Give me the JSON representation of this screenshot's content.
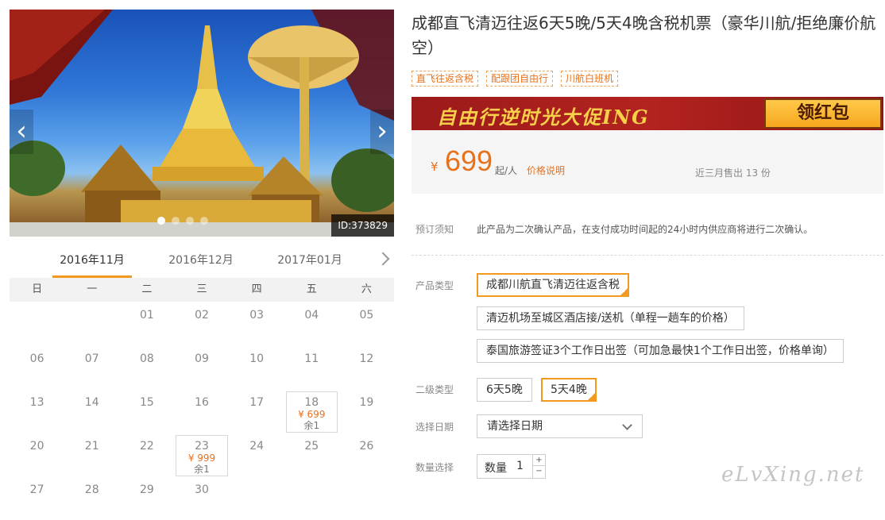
{
  "gallery": {
    "photo_id": "ID:373829",
    "prev_icon": "chevron-left-icon",
    "next_icon": "chevron-right-icon",
    "slide_count": 4,
    "active_slide": 1
  },
  "calendar": {
    "months": [
      "2016年11月",
      "2016年12月",
      "2017年01月"
    ],
    "active_month": 0,
    "weekdays": [
      "日",
      "一",
      "二",
      "三",
      "四",
      "五",
      "六"
    ],
    "rows": [
      [
        {
          "day": ""
        },
        {
          "day": ""
        },
        {
          "day": "01"
        },
        {
          "day": "02"
        },
        {
          "day": "03"
        },
        {
          "day": "04"
        },
        {
          "day": "05"
        }
      ],
      [
        {
          "day": "06"
        },
        {
          "day": "07"
        },
        {
          "day": "08"
        },
        {
          "day": "09"
        },
        {
          "day": "10"
        },
        {
          "day": "11"
        },
        {
          "day": "12"
        }
      ],
      [
        {
          "day": "13"
        },
        {
          "day": "14"
        },
        {
          "day": "15"
        },
        {
          "day": "16"
        },
        {
          "day": "17"
        },
        {
          "day": "18",
          "price": "¥ 699",
          "remain": "余1"
        },
        {
          "day": "19"
        }
      ],
      [
        {
          "day": "20"
        },
        {
          "day": "21"
        },
        {
          "day": "22"
        },
        {
          "day": "23",
          "price": "¥ 999",
          "remain": "余1"
        },
        {
          "day": "24"
        },
        {
          "day": "25"
        },
        {
          "day": "26"
        }
      ],
      [
        {
          "day": "27"
        },
        {
          "day": "28"
        },
        {
          "day": "29"
        },
        {
          "day": "30"
        },
        {
          "day": ""
        },
        {
          "day": ""
        },
        {
          "day": ""
        }
      ]
    ]
  },
  "product": {
    "title": "成都直飞清迈往返6天5晚/5天4晚含税机票（豪华川航/拒绝廉价航空）",
    "tags": [
      "直飞往返含税",
      "配跟团自由行",
      "川航白班机"
    ],
    "promo": {
      "text": "自由行逆时光大促ING",
      "button": "领红包"
    },
    "price": {
      "currency": "¥",
      "amount": "699",
      "unit": "起/人",
      "explain_link": "价格说明",
      "sold": "近三月售出 13 份"
    }
  },
  "booking": {
    "notice_label": "预订须知",
    "notice_text": "此产品为二次确认产品，在支付成功时间起的24小时内供应商将进行二次确认。",
    "type_label": "产品类型",
    "types": [
      {
        "label": "成都川航直飞清迈往返含税",
        "selected": true
      },
      {
        "label": "清迈机场至城区酒店接/送机（单程一趟车的价格）",
        "selected": false
      },
      {
        "label": "泰国旅游签证3个工作日出签（可加急最快1个工作日出签，价格单询）",
        "selected": false
      }
    ],
    "subtype_label": "二级类型",
    "subtypes": [
      {
        "label": "6天5晚",
        "selected": false
      },
      {
        "label": "5天4晚",
        "selected": true
      }
    ],
    "date_label": "选择日期",
    "date_placeholder": "请选择日期",
    "qty_label": "数量选择",
    "qty_field_label": "数量",
    "qty_value": "1",
    "qty_plus": "+",
    "qty_minus": "−"
  },
  "watermark": "eLvXing.net",
  "colors": {
    "accent": "#e8711c",
    "border_selected": "#f29a1f",
    "promo_bg": "#a51e1c",
    "promo_text": "#f7cf4a"
  }
}
